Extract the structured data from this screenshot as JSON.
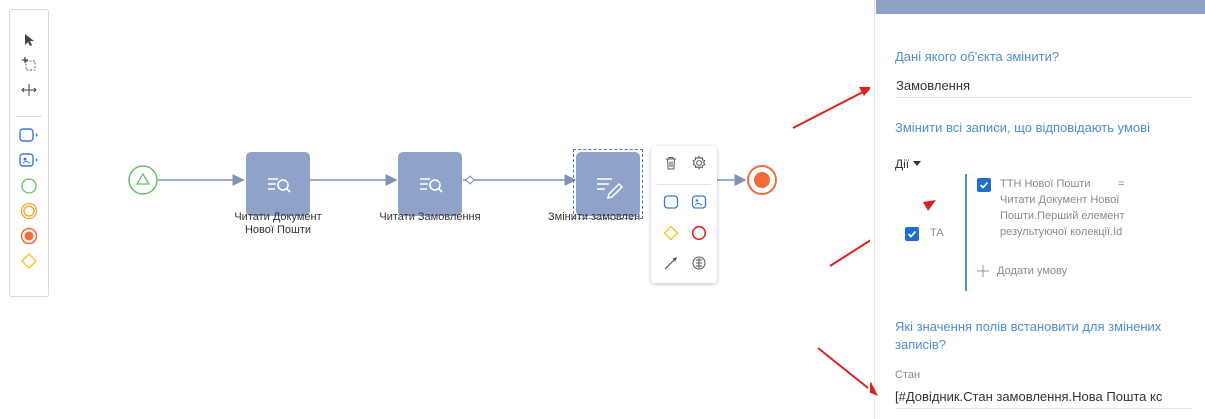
{
  "toolbar": {
    "tools": [
      "pointer-icon",
      "lasso-select-icon",
      "space-tool-icon",
      "task-icon",
      "subprocess-icon",
      "start-event-icon",
      "intermediate-event-icon",
      "end-event-icon",
      "gateway-icon"
    ]
  },
  "canvas": {
    "nodes": [
      {
        "label_line1": "Читати Документ",
        "label_line2": "Нової Пошти"
      },
      {
        "label_line1": "Читати Замовлення",
        "label_line2": ""
      },
      {
        "label_line1": "Змінити замовлен",
        "label_line2": ""
      }
    ]
  },
  "panel": {
    "object_question": "Дані якого об'єкта змінити?",
    "object_value": "Замовлення",
    "filter_question": "Змінити всі записи, що відповідають умові",
    "actions_label": "Дії",
    "and_label": "ТА",
    "condition": {
      "field": "ТТН Нової Пошти",
      "operator": "=",
      "value_line1": "Читати Документ Нової",
      "value_line2": "Пошти.Перший елемент",
      "value_line3": "результуючої колекції.Id"
    },
    "add_condition": "Додати умову",
    "values_question_line1": "Які значення полів встановити для змінених",
    "values_question_line2": "записів?",
    "field_label": "Стан",
    "field_value": "[#Довідник.Стан замовлення.Нова Пошта кс"
  },
  "colors": {
    "accent_blue": "#4f8ecf",
    "task_fill": "#8ea3c7",
    "start_green": "#62c462",
    "end_orange": "#f26b3a",
    "arrow_red": "#e02020"
  }
}
